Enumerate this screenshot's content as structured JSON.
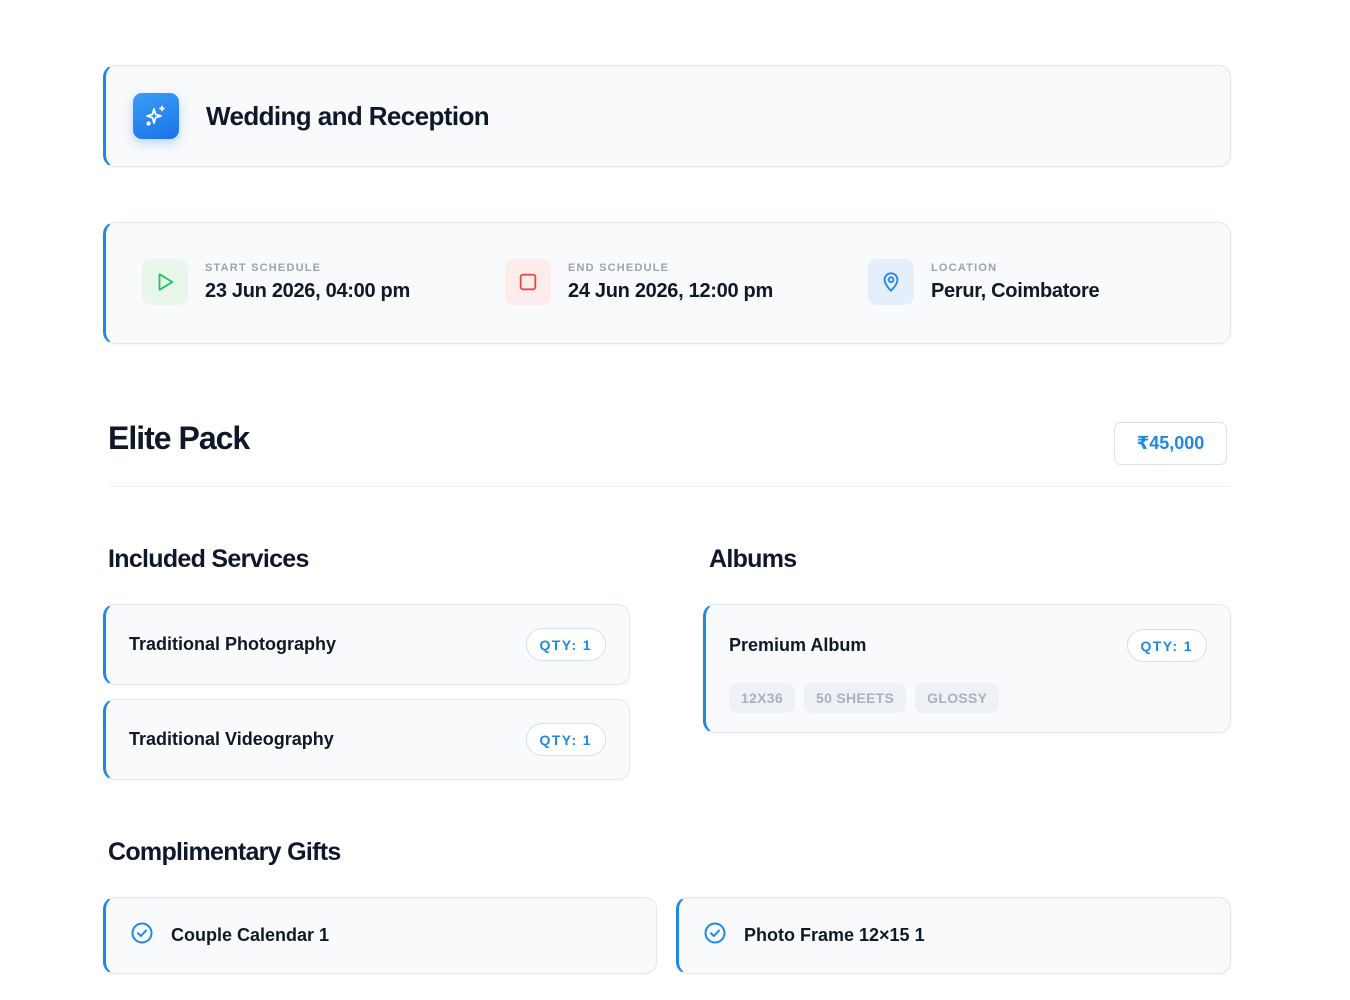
{
  "event": {
    "title": "Wedding and Reception",
    "icon": "sparkles-icon"
  },
  "schedule": {
    "start": {
      "label": "START SCHEDULE",
      "value": "23 Jun 2026, 04:00 pm",
      "icon": "play-icon"
    },
    "end": {
      "label": "END SCHEDULE",
      "value": "24 Jun 2026, 12:00 pm",
      "icon": "stop-icon"
    },
    "location": {
      "label": "LOCATION",
      "value": "Perur, Coimbatore",
      "icon": "map-pin-icon"
    }
  },
  "package": {
    "name": "Elite Pack",
    "price": "₹45,000"
  },
  "services": {
    "title": "Included Services",
    "items": [
      {
        "name": "Traditional Photography",
        "qty": "QTY: 1"
      },
      {
        "name": "Traditional Videography",
        "qty": "QTY: 1"
      }
    ]
  },
  "albums": {
    "title": "Albums",
    "items": [
      {
        "name": "Premium Album",
        "qty": "QTY: 1",
        "tags": [
          "12X36",
          "50 SHEETS",
          "GLOSSY"
        ]
      }
    ]
  },
  "gifts": {
    "title": "Complimentary Gifts",
    "items": [
      {
        "name": "Couple Calendar 1",
        "icon": "check-circle-icon"
      },
      {
        "name": "Photo Frame 12×15 1",
        "icon": "check-circle-icon"
      }
    ]
  },
  "colors": {
    "accent": "#1e88e5",
    "start_icon": "#22c55e",
    "end_icon": "#ef4444",
    "location_icon": "#1e88e5"
  }
}
